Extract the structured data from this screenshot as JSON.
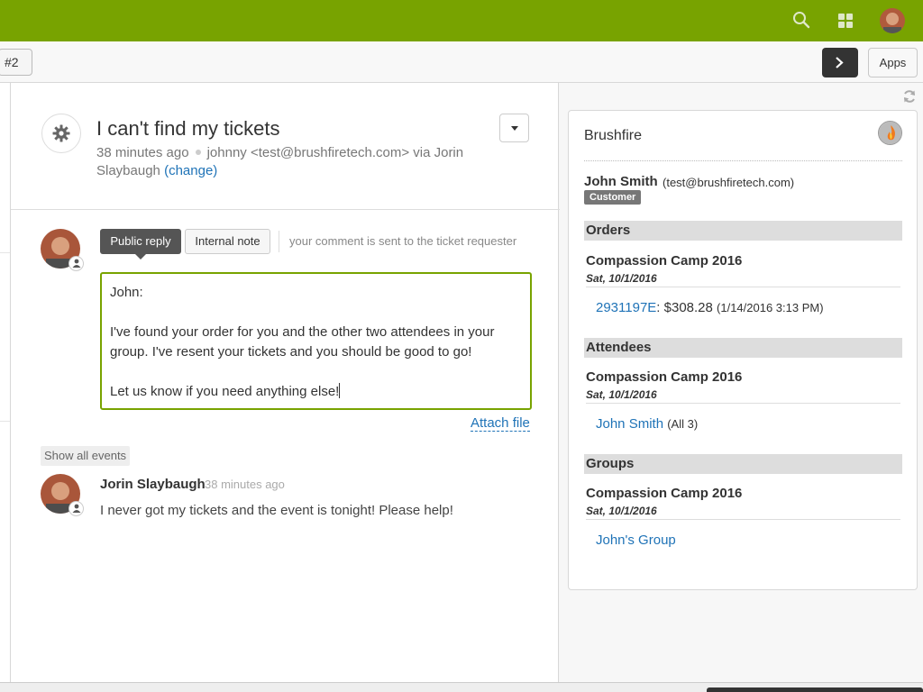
{
  "colors": {
    "topbar": "#78a300",
    "link": "#1f73b7",
    "accent_border": "#78a300"
  },
  "topbar": {
    "icons": [
      "search-icon",
      "grid-icon",
      "avatar"
    ]
  },
  "subbar": {
    "ticket_tab": "#2",
    "apps_label": "Apps",
    "next_icon": "chevron-right-icon"
  },
  "ticket": {
    "title": "I can't find my tickets",
    "age": "38 minutes ago",
    "requester": "johnny <test@brushfiretech.com> via Jorin Slaybaugh",
    "change_label": "(change)"
  },
  "composer": {
    "public_reply_label": "Public reply",
    "internal_note_label": "Internal note",
    "hint": "your comment is sent to the ticket requester",
    "body": "John:\n\nI've found your order for you and the other two attendees in your group. I've resent your tickets and you should be good to go!\n\nLet us know if you need anything else!",
    "attach_label": "Attach file"
  },
  "events": {
    "show_all_label": "Show all events",
    "items": [
      {
        "author": "Jorin Slaybaugh",
        "time": "38 minutes ago",
        "body": "I never got my tickets and the event is tonight! Please help!"
      }
    ]
  },
  "app": {
    "title": "Brushfire",
    "customer_name": "John Smith",
    "customer_email": "(test@brushfiretech.com)",
    "customer_badge": "Customer",
    "orders": {
      "heading": "Orders",
      "event": "Compassion Camp 2016",
      "date": "Sat, 10/1/2016",
      "order_id": "2931197E",
      "amount": ": $308.28",
      "order_date": "(1/14/2016 3:13 PM)"
    },
    "attendees": {
      "heading": "Attendees",
      "event": "Compassion Camp 2016",
      "date": "Sat, 10/1/2016",
      "name": "John Smith",
      "count": "(All 3)"
    },
    "groups": {
      "heading": "Groups",
      "event": "Compassion Camp 2016",
      "date": "Sat, 10/1/2016",
      "group": "John's Group"
    }
  }
}
